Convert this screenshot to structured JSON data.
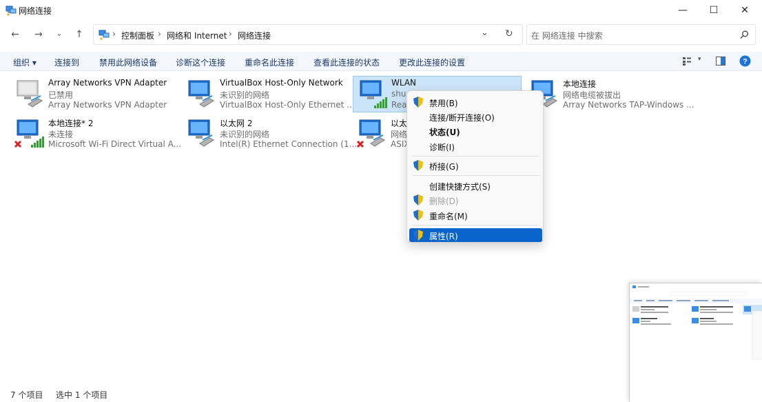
{
  "window": {
    "title": "网络连接",
    "minimize": "—",
    "maximize": "☐",
    "close": "✕"
  },
  "nav": {
    "back": "←",
    "forward": "→",
    "recent": "⌄",
    "up": "↑"
  },
  "breadcrumb": {
    "items": [
      "控制面板",
      "网络和 Internet",
      "网络连接"
    ],
    "sep": "›",
    "dropdown": "⌄",
    "refresh": "↻"
  },
  "search": {
    "placeholder": "在 网络连接 中搜索"
  },
  "commands": {
    "organize": "组织 ▾",
    "connect_to": "连接到",
    "disable": "禁用此网络设备",
    "diagnose": "诊断这个连接",
    "rename": "重命名此连接",
    "view_status": "查看此连接的状态",
    "change_settings": "更改此连接的设置"
  },
  "items": [
    {
      "name": "Array Networks VPN Adapter",
      "status": "已禁用",
      "device": "Array Networks VPN Adapter"
    },
    {
      "name": "VirtualBox Host-Only Network",
      "status": "未识别的网络",
      "device": "VirtualBox Host-Only Ethernet ..."
    },
    {
      "name": "WLAN",
      "status": "shu",
      "device": "Rea"
    },
    {
      "name": "本地连接",
      "status": "网络电缆被拔出",
      "device": "Array Networks TAP-Windows ..."
    },
    {
      "name": "本地连接* 2",
      "status": "未连接",
      "device": "Microsoft Wi-Fi Direct Virtual A..."
    },
    {
      "name": "以太网 2",
      "status": "未识别的网络",
      "device": "Intel(R) Ethernet Connection (1..."
    },
    {
      "name": "以太",
      "status": "网络",
      "device": "ASIX"
    }
  ],
  "context_menu": {
    "disable": "禁用(B)",
    "connect": "连接/断开连接(O)",
    "status": "状态(U)",
    "diagnose": "诊断(I)",
    "bridge": "桥接(G)",
    "shortcut": "创建快捷方式(S)",
    "delete": "删除(D)",
    "rename": "重命名(M)",
    "properties": "属性(R)"
  },
  "statusbar": {
    "count": "7 个项目",
    "selected": "选中 1 个项目"
  },
  "colors": {
    "accent": "#0a64c9",
    "selection": "#cce4f7",
    "link": "#1a3a6b"
  }
}
